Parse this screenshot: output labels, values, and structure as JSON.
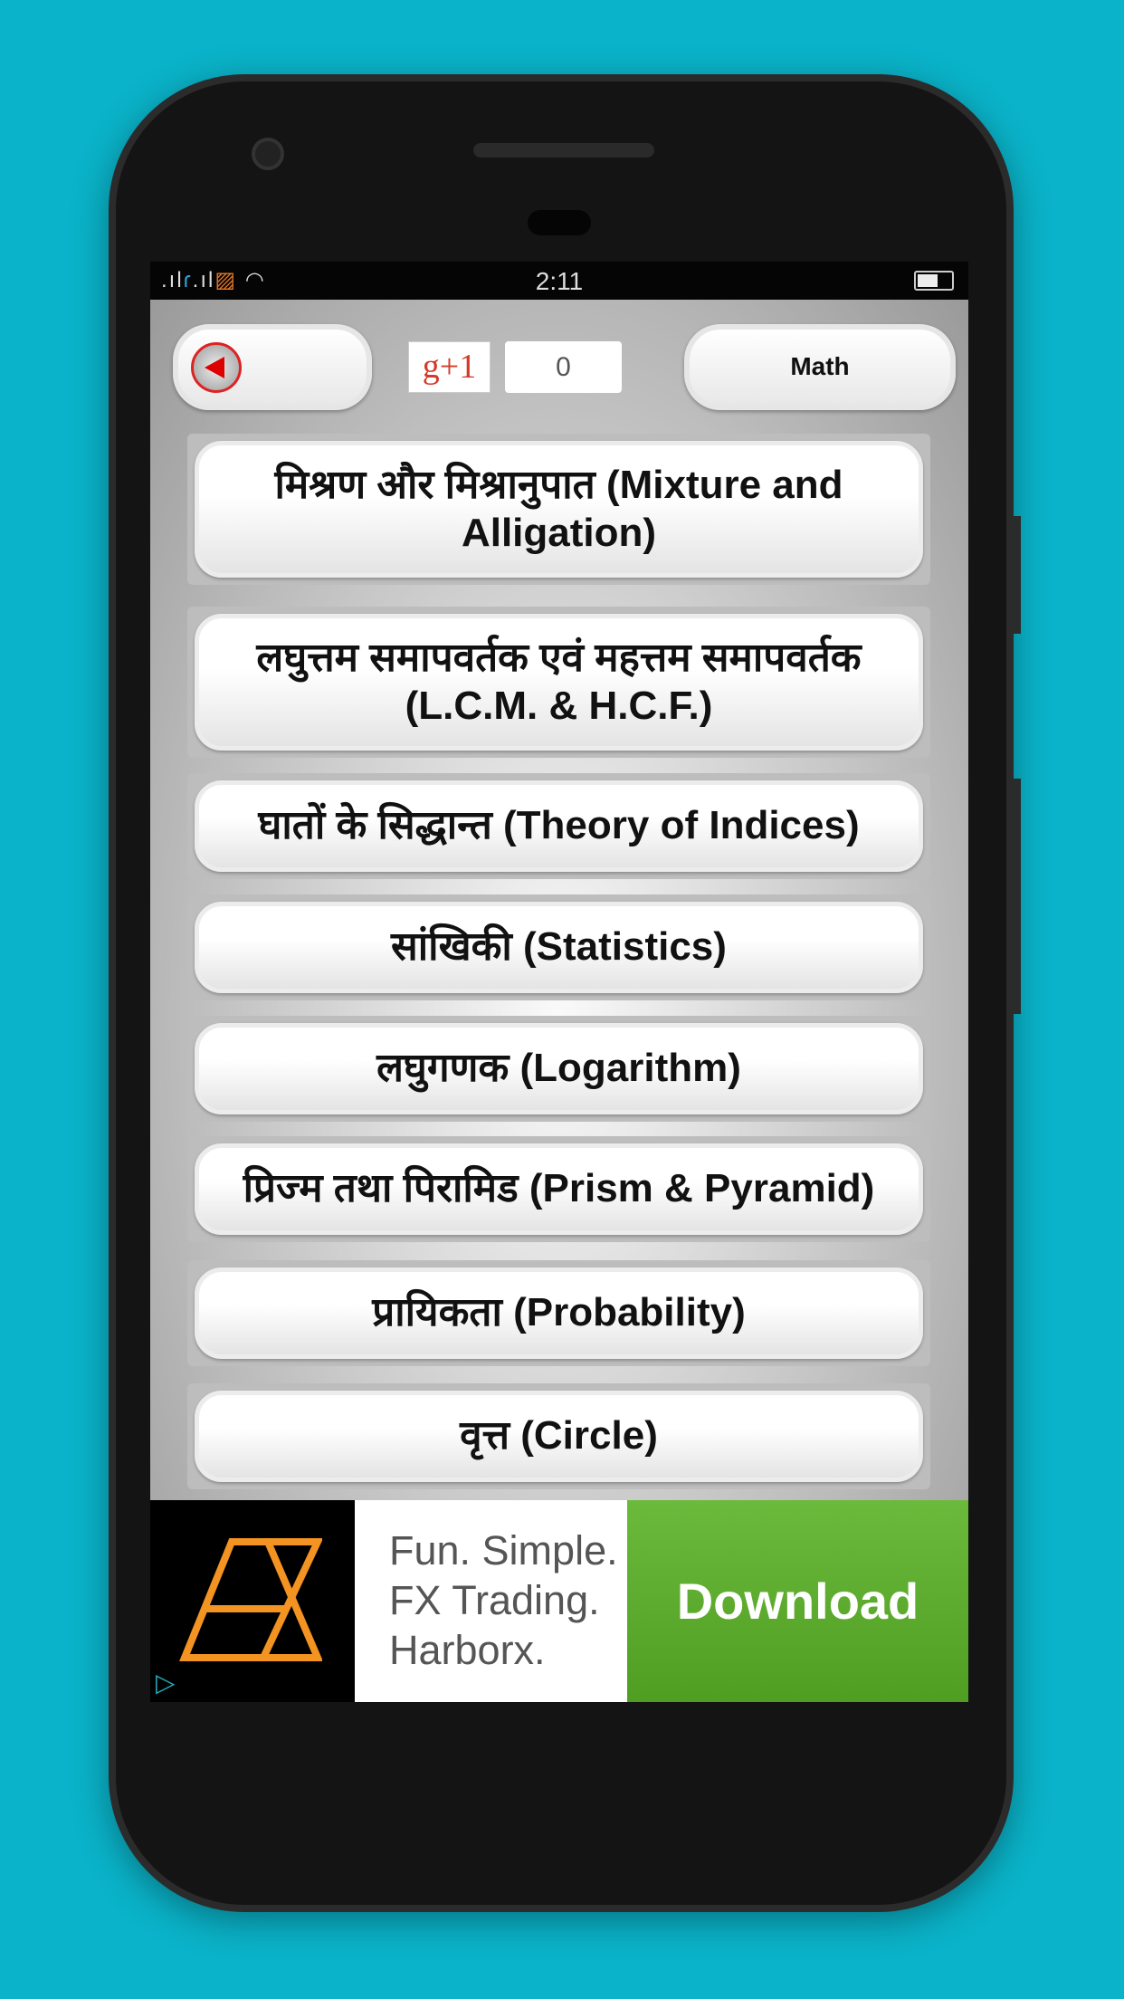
{
  "status_bar": {
    "time": "2:11",
    "icons": [
      "signal-icon",
      "telenor-icon",
      "signal-icon",
      "carrier-icon",
      "wifi-icon",
      "battery-icon"
    ]
  },
  "header": {
    "back_icon": "back-arrow-icon",
    "gplus_label": "g+1",
    "gplus_count": "0",
    "category": "Math"
  },
  "topics": [
    "मिश्रण और मिश्रानुपात (Mixture and Alligation)",
    "लघुत्तम समापवर्तक एवं महत्तम समापवर्तक (L.C.M. & H.C.F.)",
    "घातों के सिद्धान्त (Theory of Indices)",
    "सांखिकी (Statistics)",
    "लघुगणक (Logarithm)",
    "प्रिज्म तथा पिरामिड (Prism & Pyramid)",
    "प्रायिकता (Probability)",
    "वृत्त (Circle)"
  ],
  "ad": {
    "line1": "Fun. Simple.",
    "line2": "FX Trading.",
    "line3": "Harborx.",
    "cta": "Download",
    "colors": {
      "logo": "#f39322",
      "cta": "#5aab2c"
    }
  }
}
